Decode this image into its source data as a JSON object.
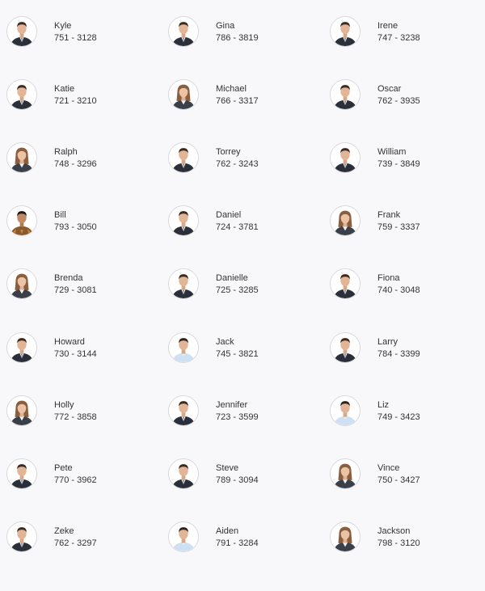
{
  "contacts": [
    {
      "name": "Kyle",
      "phone": "751 - 3128",
      "avatar": "male-suit-avatar"
    },
    {
      "name": "Gina",
      "phone": "786 - 3819",
      "avatar": "male-suit-avatar"
    },
    {
      "name": "Irene",
      "phone": "747 - 3238",
      "avatar": "male-suit-avatar"
    },
    {
      "name": "Katie",
      "phone": "721 - 3210",
      "avatar": "male-suit-avatar"
    },
    {
      "name": "Michael",
      "phone": "766 - 3317",
      "avatar": "female-avatar"
    },
    {
      "name": "Oscar",
      "phone": "762 - 3935",
      "avatar": "male-suit-avatar"
    },
    {
      "name": "Ralph",
      "phone": "748 - 3296",
      "avatar": "female-avatar"
    },
    {
      "name": "Torrey",
      "phone": "762 - 3243",
      "avatar": "male-suit-avatar"
    },
    {
      "name": "William",
      "phone": "739 - 3849",
      "avatar": "male-suit-avatar"
    },
    {
      "name": "Bill",
      "phone": "793 - 3050",
      "avatar": "male-casual-avatar"
    },
    {
      "name": "Daniel",
      "phone": "724 - 3781",
      "avatar": "male-suit-avatar"
    },
    {
      "name": "Frank",
      "phone": "759 - 3337",
      "avatar": "female-avatar"
    },
    {
      "name": "Brenda",
      "phone": "729 - 3081",
      "avatar": "female-avatar"
    },
    {
      "name": "Danielle",
      "phone": "725 - 3285",
      "avatar": "male-suit-avatar"
    },
    {
      "name": "Fiona",
      "phone": "740 - 3048",
      "avatar": "male-suit-avatar"
    },
    {
      "name": "Howard",
      "phone": "730 - 3144",
      "avatar": "male-suit-avatar"
    },
    {
      "name": "Jack",
      "phone": "745 - 3821",
      "avatar": "male-shirt-avatar"
    },
    {
      "name": "Larry",
      "phone": "784 - 3399",
      "avatar": "male-suit-avatar"
    },
    {
      "name": "Holly",
      "phone": "772 - 3858",
      "avatar": "female-avatar"
    },
    {
      "name": "Jennifer",
      "phone": "723 - 3599",
      "avatar": "male-suit-avatar"
    },
    {
      "name": "Liz",
      "phone": "749 - 3423",
      "avatar": "male-shirt-avatar"
    },
    {
      "name": "Pete",
      "phone": "770 - 3962",
      "avatar": "male-suit-avatar"
    },
    {
      "name": "Steve",
      "phone": "789 - 3094",
      "avatar": "male-suit-avatar"
    },
    {
      "name": "Vince",
      "phone": "750 - 3427",
      "avatar": "female-avatar"
    },
    {
      "name": "Zeke",
      "phone": "762 - 3297",
      "avatar": "male-suit-avatar"
    },
    {
      "name": "Aiden",
      "phone": "791 - 3284",
      "avatar": "male-shirt-avatar"
    },
    {
      "name": "Jackson",
      "phone": "798 - 3120",
      "avatar": "female-avatar"
    }
  ],
  "colors": {
    "background": "#f8f8fa",
    "text": "#333333",
    "avatar_border": "#d7d7dc"
  }
}
